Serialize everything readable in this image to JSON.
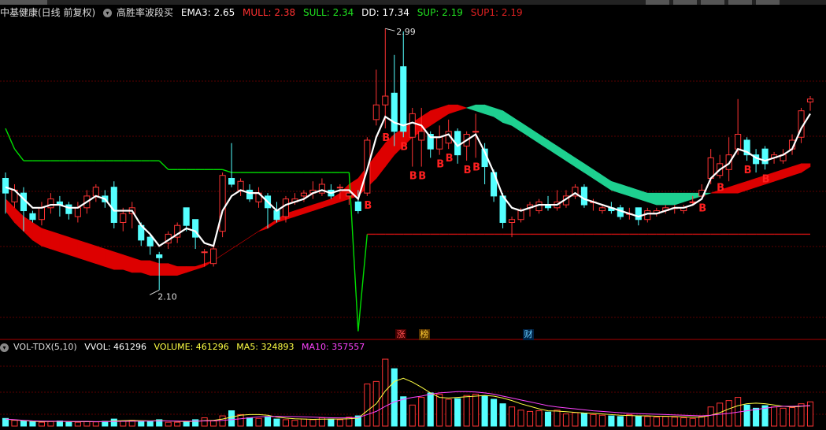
{
  "main_header": {
    "title": "中基健康(日线 前复权)",
    "indicator": "高胜率波段买",
    "ema3": "EMA3: 2.65",
    "mull": "MULL: 2.38",
    "sull": "SULL: 2.34",
    "dd": "DD: 17.34",
    "sup": "SUP: 2.19",
    "sup1": "SUP1: 2.19"
  },
  "price_labels": {
    "high": "2.99",
    "low": "2.10"
  },
  "event_tags": {
    "zhang": "涨",
    "bang": "榜",
    "cai": "财"
  },
  "signal_letter": "B",
  "vol_header": {
    "name": "VOL-TDX(5,10)",
    "vvol": "VVOL: 461296",
    "volume": "VOLUME: 461296",
    "ma5": "MA5: 324893",
    "ma10": "MA10: 357557"
  },
  "colors": {
    "up": "#ff3333",
    "down": "#54ffff",
    "ema": "#ffffff",
    "green_band": "#1ed090",
    "red_band": "#dd0000",
    "sup_line": "#00dd00",
    "ma5": "#ffff44",
    "ma10": "#ff44ff",
    "grid": "#5a0000"
  },
  "chart_data": {
    "type": "candlestick",
    "y_range_price": [
      1.94,
      3.02
    ],
    "candles": [
      {
        "o": 2.48,
        "c": 2.43,
        "h": 2.5,
        "l": 2.36
      },
      {
        "o": 2.4,
        "c": 2.44,
        "h": 2.46,
        "l": 2.38
      },
      {
        "o": 2.43,
        "c": 2.37,
        "h": 2.45,
        "l": 2.3
      },
      {
        "o": 2.36,
        "c": 2.34,
        "h": 2.37,
        "l": 2.33
      },
      {
        "o": 2.34,
        "c": 2.38,
        "h": 2.4,
        "l": 2.32
      },
      {
        "o": 2.38,
        "c": 2.41,
        "h": 2.43,
        "l": 2.36
      },
      {
        "o": 2.4,
        "c": 2.39,
        "h": 2.42,
        "l": 2.35
      },
      {
        "o": 2.39,
        "c": 2.36,
        "h": 2.4,
        "l": 2.34
      },
      {
        "o": 2.35,
        "c": 2.38,
        "h": 2.4,
        "l": 2.33
      },
      {
        "o": 2.38,
        "c": 2.42,
        "h": 2.44,
        "l": 2.36
      },
      {
        "o": 2.42,
        "c": 2.45,
        "h": 2.46,
        "l": 2.4
      },
      {
        "o": 2.42,
        "c": 2.4,
        "h": 2.44,
        "l": 2.38
      },
      {
        "o": 2.45,
        "c": 2.33,
        "h": 2.47,
        "l": 2.31
      },
      {
        "o": 2.33,
        "c": 2.36,
        "h": 2.38,
        "l": 2.3
      },
      {
        "o": 2.36,
        "c": 2.38,
        "h": 2.4,
        "l": 2.31
      },
      {
        "o": 2.32,
        "c": 2.27,
        "h": 2.33,
        "l": 2.25
      },
      {
        "o": 2.28,
        "c": 2.25,
        "h": 2.29,
        "l": 2.22
      },
      {
        "o": 2.22,
        "c": 2.21,
        "h": 2.23,
        "l": 2.1
      },
      {
        "o": 2.26,
        "c": 2.29,
        "h": 2.3,
        "l": 2.24
      },
      {
        "o": 2.28,
        "c": 2.32,
        "h": 2.33,
        "l": 2.26
      },
      {
        "o": 2.38,
        "c": 2.32,
        "h": 2.38,
        "l": 2.3
      },
      {
        "o": 2.34,
        "c": 2.28,
        "h": 2.34,
        "l": 2.24
      },
      {
        "o": 2.23,
        "c": 2.23,
        "h": 2.24,
        "l": 2.18
      },
      {
        "o": 2.19,
        "c": 2.24,
        "h": 2.25,
        "l": 2.18
      },
      {
        "o": 2.3,
        "c": 2.49,
        "h": 2.5,
        "l": 2.28
      },
      {
        "o": 2.48,
        "c": 2.46,
        "h": 2.6,
        "l": 2.45
      },
      {
        "o": 2.44,
        "c": 2.47,
        "h": 2.48,
        "l": 2.42
      },
      {
        "o": 2.44,
        "c": 2.41,
        "h": 2.46,
        "l": 2.4
      },
      {
        "o": 2.4,
        "c": 2.43,
        "h": 2.45,
        "l": 2.38
      },
      {
        "o": 2.42,
        "c": 2.38,
        "h": 2.43,
        "l": 2.31
      },
      {
        "o": 2.37,
        "c": 2.34,
        "h": 2.4,
        "l": 2.33
      },
      {
        "o": 2.35,
        "c": 2.41,
        "h": 2.42,
        "l": 2.33
      },
      {
        "o": 2.4,
        "c": 2.41,
        "h": 2.43,
        "l": 2.39
      },
      {
        "o": 2.42,
        "c": 2.43,
        "h": 2.44,
        "l": 2.4
      },
      {
        "o": 2.43,
        "c": 2.44,
        "h": 2.47,
        "l": 2.41
      },
      {
        "o": 2.43,
        "c": 2.46,
        "h": 2.48,
        "l": 2.42
      },
      {
        "o": 2.44,
        "c": 2.42,
        "h": 2.46,
        "l": 2.41
      },
      {
        "o": 2.45,
        "c": 2.45,
        "h": 2.46,
        "l": 2.41
      },
      {
        "o": 2.42,
        "c": 2.43,
        "h": 2.44,
        "l": 2.39
      },
      {
        "o": 2.4,
        "c": 2.37,
        "h": 2.44,
        "l": 2.36
      },
      {
        "o": 2.43,
        "c": 2.61,
        "h": 2.62,
        "l": 2.42
      },
      {
        "o": 2.68,
        "c": 2.73,
        "h": 2.85,
        "l": 2.66
      },
      {
        "o": 2.73,
        "c": 2.76,
        "h": 2.99,
        "l": 2.65
      },
      {
        "o": 2.77,
        "c": 2.64,
        "h": 2.9,
        "l": 2.59
      },
      {
        "o": 2.86,
        "c": 2.64,
        "h": 2.98,
        "l": 2.62
      },
      {
        "o": 2.62,
        "c": 2.7,
        "h": 2.72,
        "l": 2.52
      },
      {
        "o": 2.61,
        "c": 2.64,
        "h": 2.72,
        "l": 2.52
      },
      {
        "o": 2.63,
        "c": 2.58,
        "h": 2.64,
        "l": 2.55
      },
      {
        "o": 2.58,
        "c": 2.62,
        "h": 2.66,
        "l": 2.56
      },
      {
        "o": 2.6,
        "c": 2.64,
        "h": 2.68,
        "l": 2.58
      },
      {
        "o": 2.64,
        "c": 2.56,
        "h": 2.65,
        "l": 2.53
      },
      {
        "o": 2.59,
        "c": 2.63,
        "h": 2.64,
        "l": 2.54
      },
      {
        "o": 2.64,
        "c": 2.64,
        "h": 2.7,
        "l": 2.55
      },
      {
        "o": 2.58,
        "c": 2.52,
        "h": 2.6,
        "l": 2.46
      },
      {
        "o": 2.5,
        "c": 2.42,
        "h": 2.51,
        "l": 2.4
      },
      {
        "o": 2.42,
        "c": 2.33,
        "h": 2.43,
        "l": 2.31
      },
      {
        "o": 2.33,
        "c": 2.34,
        "h": 2.35,
        "l": 2.28
      },
      {
        "o": 2.34,
        "c": 2.37,
        "h": 2.38,
        "l": 2.33
      },
      {
        "o": 2.38,
        "c": 2.39,
        "h": 2.4,
        "l": 2.35
      },
      {
        "o": 2.37,
        "c": 2.4,
        "h": 2.41,
        "l": 2.36
      },
      {
        "o": 2.39,
        "c": 2.38,
        "h": 2.42,
        "l": 2.37
      },
      {
        "o": 2.38,
        "c": 2.4,
        "h": 2.44,
        "l": 2.37
      },
      {
        "o": 2.39,
        "c": 2.42,
        "h": 2.44,
        "l": 2.38
      },
      {
        "o": 2.42,
        "c": 2.45,
        "h": 2.46,
        "l": 2.41
      },
      {
        "o": 2.45,
        "c": 2.39,
        "h": 2.46,
        "l": 2.38
      },
      {
        "o": 2.4,
        "c": 2.4,
        "h": 2.41,
        "l": 2.37
      },
      {
        "o": 2.37,
        "c": 2.38,
        "h": 2.39,
        "l": 2.36
      },
      {
        "o": 2.38,
        "c": 2.37,
        "h": 2.4,
        "l": 2.36
      },
      {
        "o": 2.38,
        "c": 2.35,
        "h": 2.39,
        "l": 2.34
      },
      {
        "o": 2.36,
        "c": 2.36,
        "h": 2.38,
        "l": 2.34
      },
      {
        "o": 2.38,
        "c": 2.34,
        "h": 2.38,
        "l": 2.32
      },
      {
        "o": 2.34,
        "c": 2.37,
        "h": 2.38,
        "l": 2.33
      },
      {
        "o": 2.36,
        "c": 2.37,
        "h": 2.38,
        "l": 2.35
      },
      {
        "o": 2.37,
        "c": 2.38,
        "h": 2.39,
        "l": 2.36
      },
      {
        "o": 2.38,
        "c": 2.38,
        "h": 2.39,
        "l": 2.36
      },
      {
        "o": 2.37,
        "c": 2.38,
        "h": 2.39,
        "l": 2.36
      },
      {
        "o": 2.4,
        "c": 2.4,
        "h": 2.42,
        "l": 2.39
      },
      {
        "o": 2.42,
        "c": 2.44,
        "h": 2.46,
        "l": 2.41
      },
      {
        "o": 2.48,
        "c": 2.55,
        "h": 2.58,
        "l": 2.46
      },
      {
        "o": 2.49,
        "c": 2.53,
        "h": 2.56,
        "l": 2.48
      },
      {
        "o": 2.51,
        "c": 2.56,
        "h": 2.62,
        "l": 2.47
      },
      {
        "o": 2.58,
        "c": 2.63,
        "h": 2.75,
        "l": 2.56
      },
      {
        "o": 2.61,
        "c": 2.56,
        "h": 2.62,
        "l": 2.54
      },
      {
        "o": 2.56,
        "c": 2.53,
        "h": 2.58,
        "l": 2.5
      },
      {
        "o": 2.58,
        "c": 2.53,
        "h": 2.59,
        "l": 2.51
      },
      {
        "o": 2.55,
        "c": 2.56,
        "h": 2.57,
        "l": 2.53
      },
      {
        "o": 2.54,
        "c": 2.56,
        "h": 2.58,
        "l": 2.53
      },
      {
        "o": 2.58,
        "c": 2.61,
        "h": 2.63,
        "l": 2.56
      },
      {
        "o": 2.62,
        "c": 2.71,
        "h": 2.72,
        "l": 2.6
      },
      {
        "o": 2.74,
        "c": 2.75,
        "h": 2.76,
        "l": 2.71
      }
    ],
    "ema3": [
      2.45,
      2.44,
      2.41,
      2.38,
      2.38,
      2.39,
      2.39,
      2.38,
      2.38,
      2.4,
      2.42,
      2.41,
      2.37,
      2.37,
      2.37,
      2.32,
      2.29,
      2.25,
      2.27,
      2.29,
      2.31,
      2.3,
      2.26,
      2.25,
      2.37,
      2.42,
      2.44,
      2.43,
      2.43,
      2.4,
      2.37,
      2.39,
      2.4,
      2.41,
      2.43,
      2.44,
      2.43,
      2.44,
      2.44,
      2.41,
      2.51,
      2.62,
      2.69,
      2.67,
      2.66,
      2.67,
      2.66,
      2.62,
      2.62,
      2.63,
      2.59,
      2.61,
      2.63,
      2.57,
      2.5,
      2.42,
      2.38,
      2.37,
      2.38,
      2.39,
      2.39,
      2.39,
      2.41,
      2.43,
      2.41,
      2.4,
      2.39,
      2.38,
      2.37,
      2.36,
      2.35,
      2.36,
      2.36,
      2.37,
      2.38,
      2.38,
      2.39,
      2.41,
      2.48,
      2.51,
      2.53,
      2.58,
      2.57,
      2.55,
      2.54,
      2.55,
      2.56,
      2.58,
      2.65,
      2.7
    ],
    "band_mull": [
      2.41,
      2.38,
      2.35,
      2.33,
      2.31,
      2.3,
      2.29,
      2.28,
      2.27,
      2.26,
      2.25,
      2.24,
      2.23,
      2.22,
      2.21,
      2.2,
      2.2,
      2.19,
      2.19,
      2.18,
      2.18,
      2.18,
      2.19,
      2.2,
      2.22,
      2.24,
      2.26,
      2.28,
      2.3,
      2.32,
      2.34,
      2.36,
      2.37,
      2.38,
      2.39,
      2.4,
      2.41,
      2.43,
      2.46,
      2.48,
      2.52,
      2.56,
      2.6,
      2.63,
      2.65,
      2.67,
      2.69,
      2.71,
      2.72,
      2.73,
      2.73,
      2.72,
      2.71,
      2.7,
      2.69,
      2.67,
      2.66,
      2.64,
      2.62,
      2.6,
      2.58,
      2.56,
      2.54,
      2.52,
      2.5,
      2.48,
      2.46,
      2.44,
      2.43,
      2.42,
      2.41,
      2.4,
      2.39,
      2.39,
      2.39,
      2.4,
      2.41,
      2.42,
      2.43,
      2.44,
      2.45,
      2.46,
      2.47,
      2.48,
      2.49,
      2.5,
      2.51,
      2.52,
      2.53,
      2.53
    ],
    "band_sull": [
      2.37,
      2.33,
      2.3,
      2.27,
      2.25,
      2.24,
      2.23,
      2.22,
      2.21,
      2.2,
      2.19,
      2.18,
      2.17,
      2.17,
      2.16,
      2.16,
      2.15,
      2.15,
      2.15,
      2.15,
      2.16,
      2.17,
      2.18,
      2.2,
      2.22,
      2.24,
      2.26,
      2.28,
      2.3,
      2.31,
      2.33,
      2.34,
      2.35,
      2.36,
      2.37,
      2.38,
      2.39,
      2.4,
      2.41,
      2.42,
      2.45,
      2.48,
      2.52,
      2.56,
      2.59,
      2.62,
      2.64,
      2.66,
      2.68,
      2.7,
      2.71,
      2.72,
      2.73,
      2.73,
      2.72,
      2.71,
      2.69,
      2.67,
      2.65,
      2.63,
      2.61,
      2.59,
      2.57,
      2.55,
      2.53,
      2.51,
      2.49,
      2.47,
      2.46,
      2.45,
      2.44,
      2.43,
      2.43,
      2.43,
      2.43,
      2.43,
      2.43,
      2.43,
      2.43,
      2.43,
      2.43,
      2.43,
      2.44,
      2.45,
      2.46,
      2.47,
      2.48,
      2.49,
      2.5,
      2.52
    ],
    "sup_line": [
      2.65,
      2.58,
      2.54,
      2.54,
      2.54,
      2.54,
      2.54,
      2.54,
      2.54,
      2.54,
      2.54,
      2.54,
      2.54,
      2.54,
      2.54,
      2.54,
      2.54,
      2.54,
      2.51,
      2.51,
      2.51,
      2.51,
      2.51,
      2.51,
      2.51,
      2.5,
      2.5,
      2.5,
      2.5,
      2.5,
      2.5,
      2.5,
      2.5,
      2.5,
      2.5,
      2.5,
      2.5,
      2.5,
      2.5,
      1.96,
      2.29,
      2.29,
      2.29,
      2.29,
      2.29,
      2.29,
      2.29,
      2.29,
      2.29,
      2.29,
      2.29,
      2.29,
      2.29,
      2.29,
      2.29,
      2.29,
      2.29,
      2.29,
      2.29,
      2.29,
      2.29,
      2.29,
      2.29,
      2.29,
      2.29,
      2.29,
      2.29,
      2.29,
      2.29,
      2.29,
      2.29,
      2.29,
      2.29,
      2.29,
      2.29,
      2.29,
      2.29,
      2.29,
      2.29,
      2.29,
      2.29,
      2.29,
      2.29,
      2.29,
      2.29,
      2.29,
      2.29,
      2.29,
      2.29,
      2.29
    ],
    "b_signal_indices": [
      40,
      42,
      44,
      45,
      46,
      48,
      49,
      51,
      52,
      77,
      79,
      82,
      84
    ],
    "volume": [
      120,
      90,
      80,
      70,
      60,
      70,
      80,
      60,
      60,
      70,
      65,
      75,
      110,
      80,
      90,
      70,
      75,
      100,
      60,
      60,
      70,
      100,
      130,
      80,
      160,
      240,
      180,
      130,
      120,
      150,
      110,
      100,
      90,
      110,
      100,
      130,
      110,
      100,
      140,
      160,
      660,
      700,
      1050,
      900,
      460,
      330,
      450,
      520,
      500,
      420,
      430,
      480,
      500,
      470,
      420,
      350,
      300,
      250,
      230,
      240,
      220,
      250,
      190,
      210,
      200,
      180,
      170,
      160,
      150,
      180,
      160,
      150,
      140,
      150,
      140,
      130,
      120,
      150,
      300,
      360,
      400,
      450,
      330,
      280,
      320,
      300,
      280,
      290,
      350,
      380
    ],
    "vol_ma5": [
      110,
      95,
      85,
      75,
      70,
      72,
      74,
      70,
      68,
      70,
      68,
      70,
      80,
      85,
      88,
      85,
      82,
      85,
      80,
      75,
      70,
      75,
      85,
      90,
      110,
      140,
      170,
      180,
      180,
      170,
      140,
      125,
      115,
      110,
      105,
      108,
      110,
      110,
      115,
      125,
      240,
      350,
      550,
      700,
      750,
      690,
      610,
      520,
      450,
      440,
      450,
      460,
      470,
      480,
      470,
      440,
      400,
      350,
      310,
      270,
      240,
      235,
      225,
      215,
      205,
      200,
      190,
      180,
      170,
      165,
      160,
      160,
      155,
      155,
      150,
      145,
      140,
      140,
      170,
      210,
      270,
      320,
      350,
      360,
      350,
      330,
      310,
      300,
      310,
      320
    ],
    "vol_ma10": [
      110,
      100,
      90,
      82,
      78,
      76,
      75,
      73,
      72,
      72,
      70,
      70,
      72,
      74,
      76,
      78,
      79,
      80,
      80,
      79,
      77,
      78,
      80,
      83,
      90,
      100,
      115,
      130,
      145,
      150,
      152,
      150,
      148,
      145,
      140,
      135,
      130,
      128,
      130,
      135,
      180,
      230,
      310,
      380,
      420,
      450,
      470,
      500,
      520,
      530,
      540,
      540,
      535,
      520,
      500,
      470,
      440,
      410,
      380,
      350,
      320,
      300,
      285,
      270,
      255,
      240,
      230,
      220,
      210,
      200,
      195,
      190,
      185,
      180,
      175,
      170,
      165,
      160,
      170,
      185,
      200,
      220,
      240,
      260,
      280,
      300,
      310,
      310,
      315,
      320
    ],
    "vol_range": [
      0,
      1100
    ],
    "grid": true
  }
}
